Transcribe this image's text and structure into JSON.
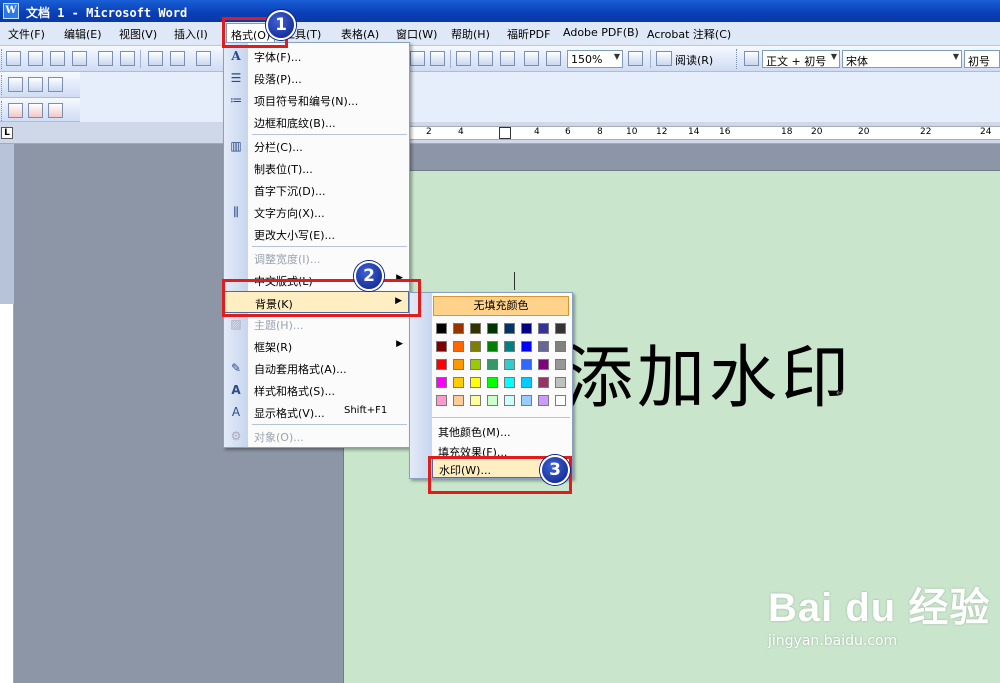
{
  "window": {
    "title": "文档 1 - Microsoft Word"
  },
  "menubar": {
    "items": [
      {
        "label": "文件(F)"
      },
      {
        "label": "编辑(E)"
      },
      {
        "label": "视图(V)"
      },
      {
        "label": "插入(I)"
      },
      {
        "label": "格式(O)"
      },
      {
        "label": "工具(T)"
      },
      {
        "label": "表格(A)"
      },
      {
        "label": "窗口(W)"
      },
      {
        "label": "帮助(H)"
      },
      {
        "label": "福昕PDF"
      },
      {
        "label": "Adobe PDF(B)"
      },
      {
        "label": "Acrobat 注释(C)"
      }
    ]
  },
  "toolbar": {
    "zoom": "150%",
    "read_label": "阅读(R)",
    "style": "正文 + 初号",
    "font": "宋体",
    "size": "初号"
  },
  "ruler": {
    "corner": "L",
    "marks": [
      "2",
      "4",
      "6",
      "8",
      "10",
      "12",
      "14",
      "16",
      "18",
      "20",
      "22",
      "24"
    ]
  },
  "format_menu": {
    "items": [
      {
        "label": "字体(F)..."
      },
      {
        "label": "段落(P)..."
      },
      {
        "label": "项目符号和编号(N)..."
      },
      {
        "label": "边框和底纹(B)..."
      },
      {
        "label": "分栏(C)..."
      },
      {
        "label": "制表位(T)..."
      },
      {
        "label": "首字下沉(D)..."
      },
      {
        "label": "文字方向(X)..."
      },
      {
        "label": "更改大小写(E)..."
      },
      {
        "label": "调整宽度(I)..."
      },
      {
        "label": "中文版式(L)"
      },
      {
        "label": "背景(K)"
      },
      {
        "label": "主题(H)..."
      },
      {
        "label": "框架(R)"
      },
      {
        "label": "自动套用格式(A)..."
      },
      {
        "label": "样式和格式(S)..."
      },
      {
        "label": "显示格式(V)...",
        "shortcut": "Shift+F1"
      },
      {
        "label": "对象(O)..."
      }
    ]
  },
  "background_submenu": {
    "no_fill": "无填充颜色",
    "more_colors": "其他颜色(M)...",
    "fill_effects": "填充效果(F)...",
    "watermark": "水印(W)...",
    "swatches": [
      "#000000",
      "#993300",
      "#333300",
      "#003300",
      "#003366",
      "#000080",
      "#333399",
      "#333333",
      "#800000",
      "#ff6600",
      "#808000",
      "#008000",
      "#008080",
      "#0000ff",
      "#666699",
      "#808080",
      "#ff0000",
      "#ff9900",
      "#99cc00",
      "#339966",
      "#33cccc",
      "#3366ff",
      "#800080",
      "#969696",
      "#ff00ff",
      "#ffcc00",
      "#ffff00",
      "#00ff00",
      "#00ffff",
      "#00ccff",
      "#993366",
      "#c0c0c0",
      "#ff99cc",
      "#ffcc99",
      "#ffff99",
      "#ccffcc",
      "#ccffff",
      "#99ccff",
      "#cc99ff",
      "#ffffff"
    ]
  },
  "document": {
    "text": "添加水印",
    "para_mark": "↵"
  },
  "callouts": [
    "1",
    "2",
    "3"
  ],
  "watermark": {
    "brand": "Bai du 经验",
    "url": "jingyan.baidu.com"
  },
  "colors": {
    "highlight": "#ffeec2",
    "callout_border": "#e21b1b",
    "page_bg": "#c9e6cc"
  }
}
